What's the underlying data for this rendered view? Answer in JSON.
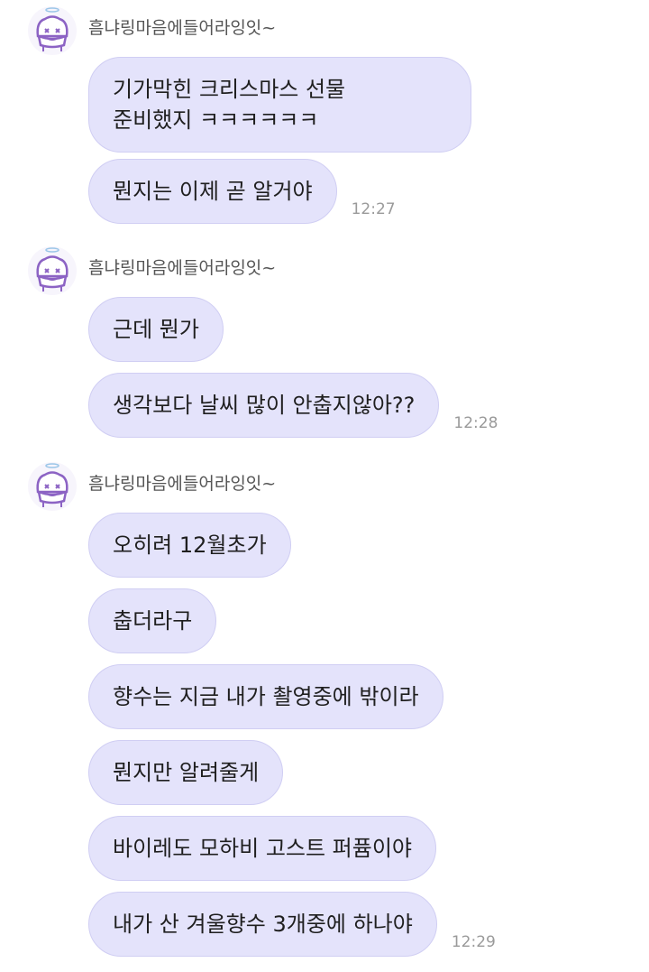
{
  "conversation": {
    "groups": [
      {
        "sender": "흠냐링마음에들어라잉잇~",
        "messages": [
          {
            "text": "기가막힌 크리스마스 선물\n준비했지 ㅋㅋㅋㅋㅋㅋ",
            "time": ""
          },
          {
            "text": "뭔지는 이제 곧 알거야",
            "time": "12:27"
          }
        ]
      },
      {
        "sender": "흠냐링마음에들어라잉잇~",
        "messages": [
          {
            "text": "근데 뭔가",
            "time": ""
          },
          {
            "text": "생각보다 날씨 많이 안춥지않아??",
            "time": "12:28"
          }
        ]
      },
      {
        "sender": "흠냐링마음에들어라잉잇~",
        "messages": [
          {
            "text": "오히려 12월초가",
            "time": ""
          },
          {
            "text": "춥더라구",
            "time": ""
          },
          {
            "text": "향수는 지금 내가 촬영중에 밖이라",
            "time": ""
          },
          {
            "text": "뭔지만 알려줄게",
            "time": ""
          },
          {
            "text": "바이레도 모하비 고스트 퍼퓸이야",
            "time": ""
          },
          {
            "text": "내가 산 겨울향수 3개중에 하나야",
            "time": "12:29"
          }
        ]
      }
    ]
  },
  "colors": {
    "bubble_bg": "#e4e3fb",
    "bubble_border": "#d0cef3",
    "avatar_outline": "#8c63c4"
  },
  "icons": {
    "avatar": "cartoon-character-avatar-icon"
  }
}
